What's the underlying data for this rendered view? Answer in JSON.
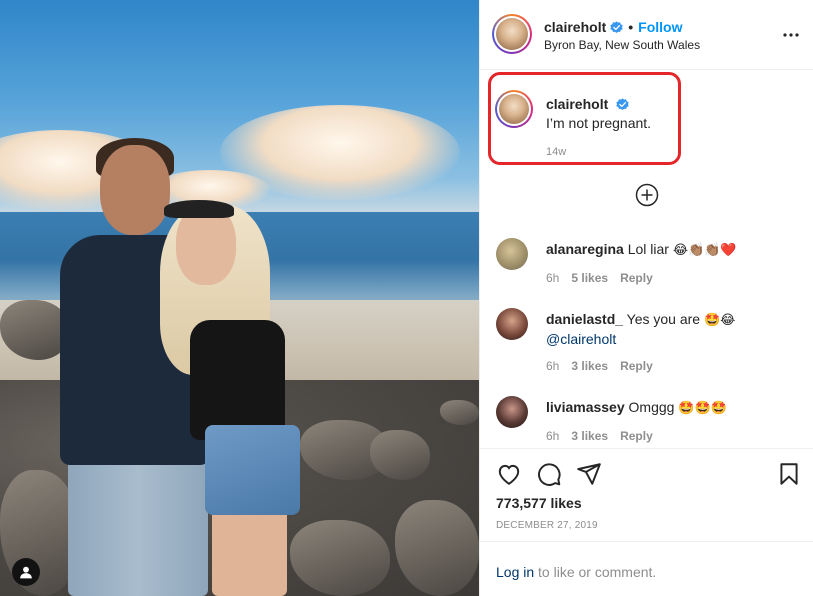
{
  "post": {
    "username": "claireholt",
    "follow_label": "Follow",
    "location": "Byron Bay, New South Wales",
    "caption": "I’m not pregnant.",
    "caption_age": "14w",
    "likes": "773,577 likes",
    "date": "DECEMBER 27, 2019"
  },
  "comments": [
    {
      "user": "alanaregina",
      "text": "Lol liar",
      "emoji": "😂👏🏽👏🏽❤️",
      "age": "6h",
      "likes": "5 likes",
      "reply": "Reply"
    },
    {
      "user": "danielastd_",
      "text": "Yes you are",
      "emoji": "🤩😂",
      "mention": "@claireholt",
      "age": "6h",
      "likes": "3 likes",
      "reply": "Reply"
    },
    {
      "user": "liviamassey",
      "text": "Omggg",
      "emoji": "🤩🤩🤩",
      "age": "6h",
      "likes": "3 likes",
      "reply": "Reply"
    }
  ],
  "footer": {
    "login_link": "Log in",
    "login_rest": " to like or comment."
  },
  "colors": {
    "follow_blue": "#0095f6",
    "highlight_red": "#e4262a",
    "verified_blue": "#3897f0"
  },
  "icons": [
    "user-tag-icon",
    "more-options-icon",
    "verified-badge-icon",
    "plus-circle-icon",
    "heart-icon",
    "comment-icon",
    "share-icon",
    "bookmark-icon"
  ]
}
